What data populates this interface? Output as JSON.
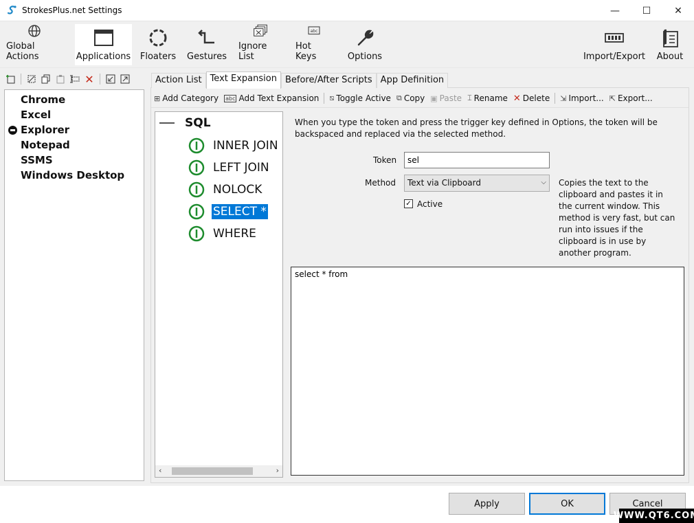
{
  "window": {
    "title": "StrokesPlus.net Settings",
    "minimize": "—",
    "maximize": "☐",
    "close": "✕"
  },
  "toolbar": {
    "items": [
      {
        "label": "Global Actions",
        "icon": "globe-icon"
      },
      {
        "label": "Applications",
        "icon": "window-icon",
        "active": true
      },
      {
        "label": "Floaters",
        "icon": "floaters-icon"
      },
      {
        "label": "Gestures",
        "icon": "gesture-icon"
      },
      {
        "label": "Ignore List",
        "icon": "ignore-icon"
      },
      {
        "label": "Hot Keys",
        "icon": "hotkeys-icon"
      },
      {
        "label": "Options",
        "icon": "wrench-icon"
      },
      {
        "label": "Import/Export",
        "icon": "import-export-icon"
      },
      {
        "label": "About",
        "icon": "about-icon"
      }
    ]
  },
  "apps": {
    "items": [
      {
        "label": "Chrome",
        "disabled": false
      },
      {
        "label": "Excel",
        "disabled": false
      },
      {
        "label": "Explorer",
        "disabled": true
      },
      {
        "label": "Notepad",
        "disabled": false
      },
      {
        "label": "SSMS",
        "disabled": false,
        "selected": true
      },
      {
        "label": "Windows Desktop",
        "disabled": false
      }
    ]
  },
  "tabs": [
    "Action List",
    "Text Expansion",
    "Before/After Scripts",
    "App Definition"
  ],
  "active_tab": "Text Expansion",
  "subtoolbar": {
    "add_category": "Add Category",
    "add_text_expansion": "Add Text Expansion",
    "toggle_active": "Toggle Active",
    "copy": "Copy",
    "paste": "Paste",
    "rename": "Rename",
    "delete": "Delete",
    "import": "Import...",
    "export": "Export..."
  },
  "tree": {
    "category": "SQL",
    "items": [
      "INNER JOIN",
      "LEFT JOIN",
      "NOLOCK",
      "SELECT *",
      "WHERE"
    ],
    "selected": "SELECT *"
  },
  "editor": {
    "description": "When you type the token and press the trigger key defined in Options, the token will be backspaced and replaced via the selected method.",
    "token_label": "Token",
    "token_value": "sel",
    "method_label": "Method",
    "method_value": "Text via Clipboard",
    "active_label": "Active",
    "active_checked": true,
    "method_help": "Copies the text to the clipboard and pastes it in the current window. This method is very fast, but can run into issues if the clipboard is in use by another program.",
    "content": "select * from"
  },
  "footer": {
    "apply": "Apply",
    "ok": "OK",
    "cancel": "Cancel"
  },
  "watermark": "WWW.QT6.COM",
  "colors": {
    "accent": "#0078d7",
    "active_green": "#1e8c2e",
    "delete_red": "#c42b1c"
  }
}
